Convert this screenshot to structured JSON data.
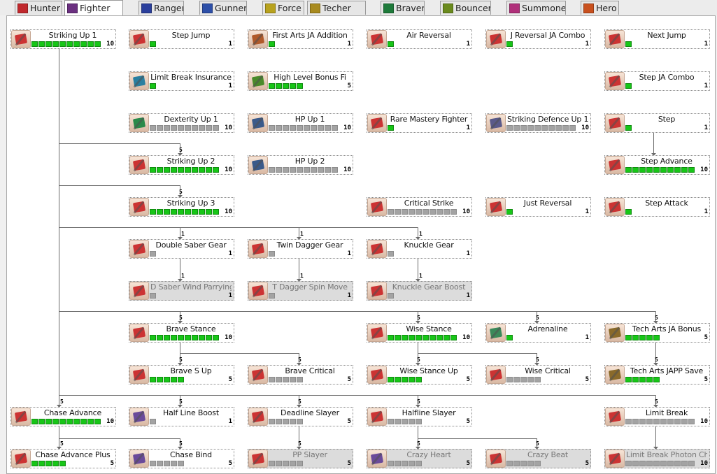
{
  "tabs": [
    {
      "label": "Hunter",
      "color": "#c0282d"
    },
    {
      "label": "Fighter",
      "color": "#6b3080",
      "active": true
    },
    {
      "label": "Ranger",
      "color": "#2a3f9c"
    },
    {
      "label": "Gunner",
      "color": "#2d4fa8"
    },
    {
      "label": "Force",
      "color": "#b8a21e"
    },
    {
      "label": "Techer",
      "color": "#a88a1e"
    },
    {
      "label": "Braver",
      "color": "#1e7a3a"
    },
    {
      "label": "Bouncer",
      "color": "#6a8a1e"
    },
    {
      "label": "Summoner",
      "color": "#b0307a"
    },
    {
      "label": "Hero",
      "color": "#c8501e"
    }
  ],
  "skills": [
    {
      "name": "Striking Up 1",
      "level": 10,
      "max": "10",
      "color": "#c33"
    },
    {
      "name": "Step Jump",
      "level": 1,
      "max": "1",
      "color": "#c33"
    },
    {
      "name": "First Arts JA Addition",
      "level": 1,
      "max": "1",
      "color": "#b05a2a"
    },
    {
      "name": "Air Reversal",
      "level": 1,
      "max": "1",
      "color": "#c33"
    },
    {
      "name": "J Reversal JA Combo",
      "level": 1,
      "max": "1",
      "color": "#c33"
    },
    {
      "name": "Next Jump",
      "level": 1,
      "max": "1",
      "color": "#c33"
    },
    {
      "name": "Limit Break Insurance",
      "level": 1,
      "max": "1",
      "color": "#2a7fa0"
    },
    {
      "name": "High Level Bonus Fi",
      "level": 5,
      "max": "5",
      "color": "#4a8a2a"
    },
    {
      "name": "Step JA Combo",
      "level": 1,
      "max": "1",
      "color": "#c33"
    },
    {
      "name": "Dexterity Up 1",
      "level": 0,
      "max": "10",
      "color": "#2a8a4a"
    },
    {
      "name": "HP Up 1",
      "level": 0,
      "max": "10",
      "color": "#3a5a8a"
    },
    {
      "name": "Rare Mastery Fighter",
      "level": 1,
      "max": "1",
      "color": "#c33"
    },
    {
      "name": "Striking Defence Up 1",
      "level": 0,
      "max": "10",
      "color": "#5a5a8a"
    },
    {
      "name": "Step",
      "level": 1,
      "max": "1",
      "color": "#c33"
    },
    {
      "name": "Striking Up 2",
      "level": 10,
      "max": "10",
      "color": "#c33"
    },
    {
      "name": "HP Up 2",
      "level": 0,
      "max": "10",
      "color": "#3a5a8a"
    },
    {
      "name": "Step Advance",
      "level": 10,
      "max": "10",
      "color": "#c33"
    },
    {
      "name": "Striking Up 3",
      "level": 10,
      "max": "10",
      "color": "#c33"
    },
    {
      "name": "Critical Strike",
      "level": 0,
      "max": "10",
      "color": "#c33"
    },
    {
      "name": "Just Reversal",
      "level": 1,
      "max": "1",
      "color": "#c33"
    },
    {
      "name": "Step Attack",
      "level": 1,
      "max": "1",
      "color": "#c33"
    },
    {
      "name": "Double Saber Gear",
      "level": 0,
      "max": "1",
      "color": "#c33"
    },
    {
      "name": "Twin Dagger Gear",
      "level": 0,
      "max": "1",
      "color": "#c33"
    },
    {
      "name": "Knuckle Gear",
      "level": 0,
      "max": "1",
      "color": "#c33"
    },
    {
      "name": "D Saber Wind Parrying",
      "level": 0,
      "max": "1",
      "color": "#c33",
      "locked": true
    },
    {
      "name": "T Dagger Spin Move",
      "level": 0,
      "max": "1",
      "color": "#c33",
      "locked": true
    },
    {
      "name": "Knuckle Gear Boost",
      "level": 0,
      "max": "1",
      "color": "#c33",
      "locked": true
    },
    {
      "name": "Brave Stance",
      "level": 10,
      "max": "10",
      "color": "#c33"
    },
    {
      "name": "Wise Stance",
      "level": 10,
      "max": "10",
      "color": "#c33"
    },
    {
      "name": "Adrenaline",
      "level": 1,
      "max": "1",
      "color": "#3a8a5a"
    },
    {
      "name": "Tech Arts JA Bonus",
      "level": 5,
      "max": "5",
      "color": "#8a6a2a"
    },
    {
      "name": "Brave S Up",
      "level": 5,
      "max": "5",
      "color": "#c33"
    },
    {
      "name": "Brave Critical",
      "level": 0,
      "max": "5",
      "color": "#c33"
    },
    {
      "name": "Wise Stance Up",
      "level": 5,
      "max": "5",
      "color": "#c33"
    },
    {
      "name": "Wise Critical",
      "level": 0,
      "max": "5",
      "color": "#c33"
    },
    {
      "name": "Tech Arts JAPP Save",
      "level": 5,
      "max": "5",
      "color": "#8a6a2a"
    },
    {
      "name": "Chase Advance",
      "level": 10,
      "max": "10",
      "color": "#c33"
    },
    {
      "name": "Half Line Boost",
      "level": 0,
      "max": "1",
      "color": "#6a4a9a"
    },
    {
      "name": "Deadline Slayer",
      "level": 0,
      "max": "5",
      "color": "#c33"
    },
    {
      "name": "Halfline Slayer",
      "level": 0,
      "max": "5",
      "color": "#c33"
    },
    {
      "name": "Limit Break",
      "level": 0,
      "max": "10",
      "color": "#c33"
    },
    {
      "name": "Chase Advance Plus",
      "level": 5,
      "max": "5",
      "color": "#c33"
    },
    {
      "name": "Chase Bind",
      "level": 0,
      "max": "5",
      "color": "#6a4a9a"
    },
    {
      "name": "PP Slayer",
      "level": 0,
      "max": "5",
      "color": "#c33",
      "locked": true
    },
    {
      "name": "Crazy Heart",
      "level": 0,
      "max": "5",
      "color": "#6a4a9a",
      "locked": true
    },
    {
      "name": "Crazy Beat",
      "level": 0,
      "max": "5",
      "color": "#c33",
      "locked": true
    },
    {
      "name": "Limit Break Photon Charge",
      "level": 0,
      "max": "10",
      "color": "#c33",
      "locked": true
    }
  ],
  "requirements": [
    {
      "label": "5"
    },
    {
      "label": "5"
    },
    {
      "label": "1"
    },
    {
      "label": "1"
    },
    {
      "label": "1"
    },
    {
      "label": "1"
    },
    {
      "label": "1"
    },
    {
      "label": "1"
    },
    {
      "label": "5"
    },
    {
      "label": "5"
    },
    {
      "label": "5"
    },
    {
      "label": "5"
    },
    {
      "label": "5"
    },
    {
      "label": "5"
    },
    {
      "label": "5"
    },
    {
      "label": "5"
    },
    {
      "label": "5"
    },
    {
      "label": "5"
    },
    {
      "label": "5"
    },
    {
      "label": "5"
    },
    {
      "label": "5"
    },
    {
      "label": "5"
    },
    {
      "label": "5"
    },
    {
      "label": "5"
    },
    {
      "label": "5"
    },
    {
      "label": "5"
    },
    {
      "label": "5"
    }
  ]
}
